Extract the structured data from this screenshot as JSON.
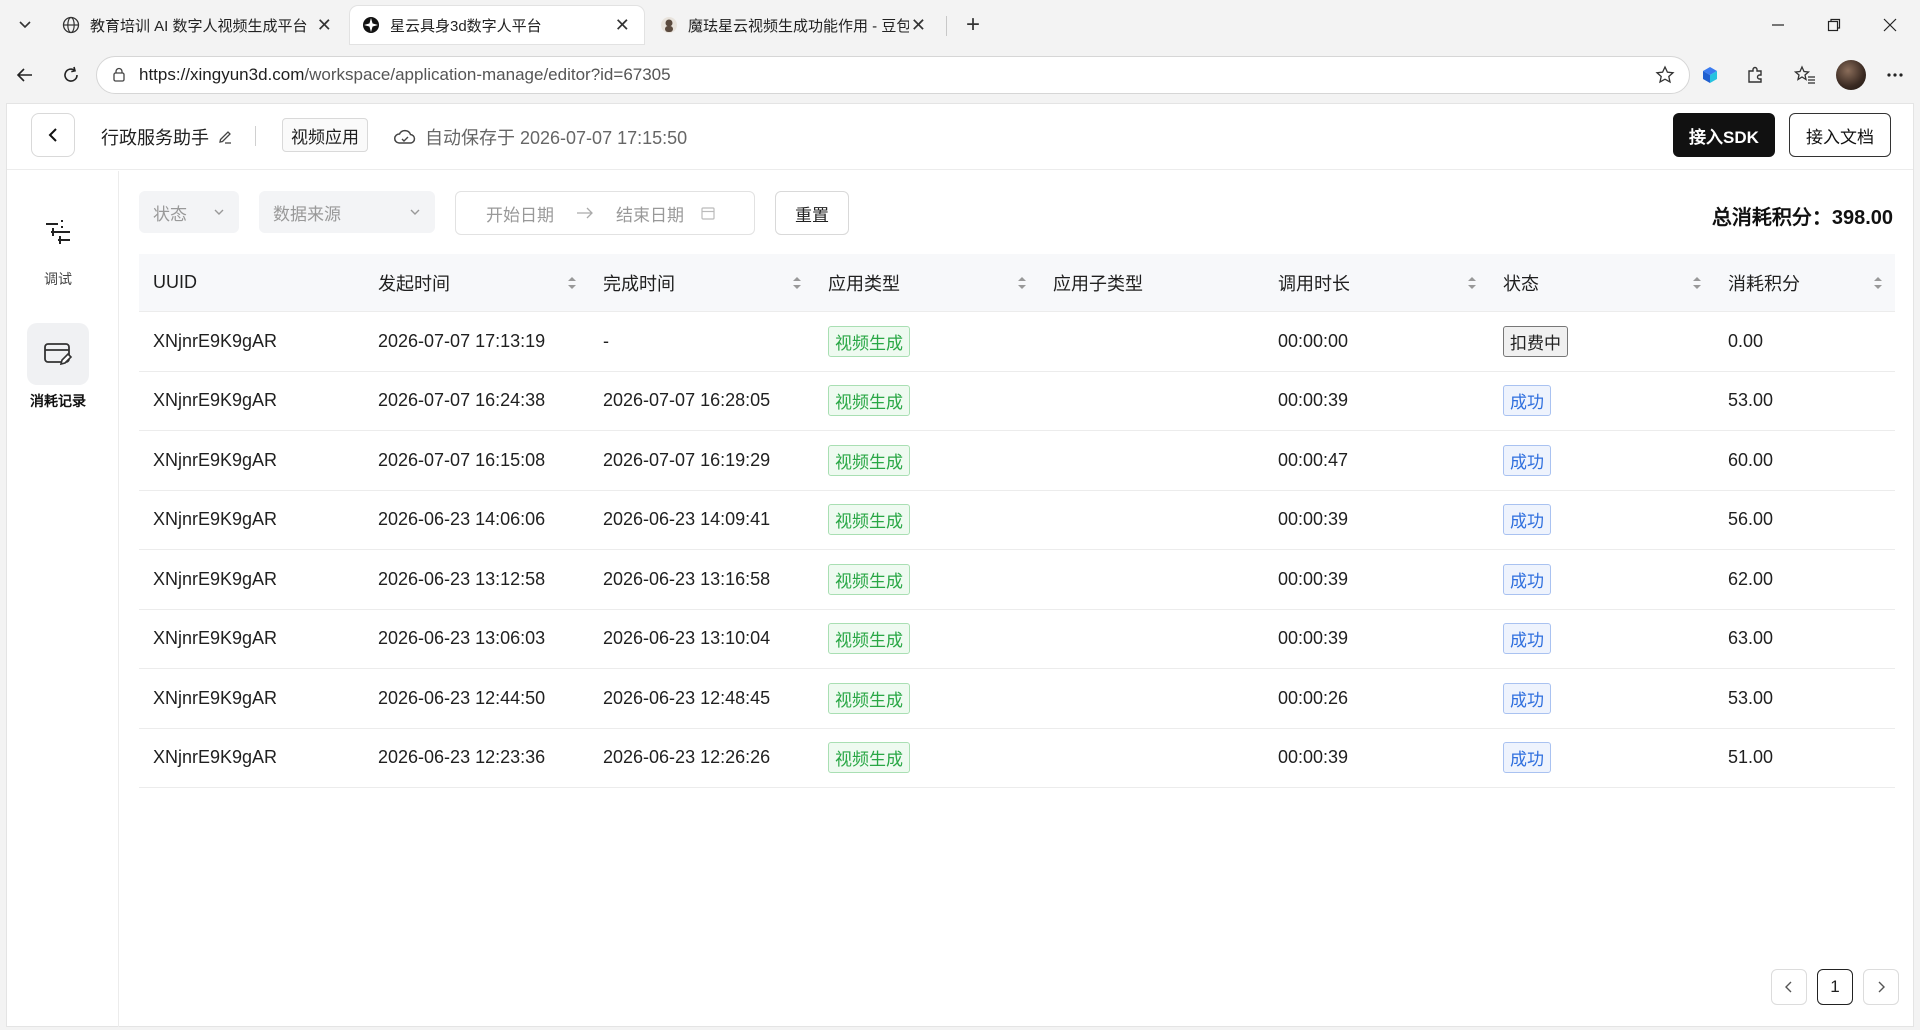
{
  "browser": {
    "tabs": [
      {
        "title": "教育培训 AI 数字人视频生成平台",
        "active": false
      },
      {
        "title": "星云具身3d数字人平台",
        "active": true
      },
      {
        "title": "魔珐星云视频生成功能作用 - 豆包",
        "active": false
      }
    ],
    "url_host": "https://xingyun3d.com",
    "url_path": "/workspace/application-manage/editor?id=67305"
  },
  "header": {
    "app_name": "行政服务助手",
    "app_type": "视频应用",
    "autosave": "自动保存于 2026-07-07 17:15:50",
    "sdk_button": "接入SDK",
    "doc_button": "接入文档"
  },
  "sidenav": {
    "items": [
      {
        "label": "调试",
        "icon": "sliders-icon",
        "active": false
      },
      {
        "label": "消耗记录",
        "icon": "card-edit-icon",
        "active": true
      }
    ]
  },
  "filters": {
    "status_placeholder": "状态",
    "source_placeholder": "数据来源",
    "start_date": "开始日期",
    "end_date": "结束日期",
    "reset": "重置",
    "total_label": "总消耗积分：398.00"
  },
  "table": {
    "columns": [
      "UUID",
      "发起时间",
      "完成时间",
      "应用类型",
      "应用子类型",
      "调用时长",
      "状态",
      "消耗积分"
    ],
    "rows": [
      {
        "uuid": "XNjnrE9K9gAR",
        "start": "2026-07-07 17:13:19",
        "end": "-",
        "type": "视频生成",
        "subtype": "",
        "duration": "00:00:00",
        "status": "扣费中",
        "status_kind": "gray",
        "points": "0.00"
      },
      {
        "uuid": "XNjnrE9K9gAR",
        "start": "2026-07-07 16:24:38",
        "end": "2026-07-07 16:28:05",
        "type": "视频生成",
        "subtype": "",
        "duration": "00:00:39",
        "status": "成功",
        "status_kind": "blue",
        "points": "53.00"
      },
      {
        "uuid": "XNjnrE9K9gAR",
        "start": "2026-07-07 16:15:08",
        "end": "2026-07-07 16:19:29",
        "type": "视频生成",
        "subtype": "",
        "duration": "00:00:47",
        "status": "成功",
        "status_kind": "blue",
        "points": "60.00"
      },
      {
        "uuid": "XNjnrE9K9gAR",
        "start": "2026-06-23 14:06:06",
        "end": "2026-06-23 14:09:41",
        "type": "视频生成",
        "subtype": "",
        "duration": "00:00:39",
        "status": "成功",
        "status_kind": "blue",
        "points": "56.00"
      },
      {
        "uuid": "XNjnrE9K9gAR",
        "start": "2026-06-23 13:12:58",
        "end": "2026-06-23 13:16:58",
        "type": "视频生成",
        "subtype": "",
        "duration": "00:00:39",
        "status": "成功",
        "status_kind": "blue",
        "points": "62.00"
      },
      {
        "uuid": "XNjnrE9K9gAR",
        "start": "2026-06-23 13:06:03",
        "end": "2026-06-23 13:10:04",
        "type": "视频生成",
        "subtype": "",
        "duration": "00:00:39",
        "status": "成功",
        "status_kind": "blue",
        "points": "63.00"
      },
      {
        "uuid": "XNjnrE9K9gAR",
        "start": "2026-06-23 12:44:50",
        "end": "2026-06-23 12:48:45",
        "type": "视频生成",
        "subtype": "",
        "duration": "00:00:26",
        "status": "成功",
        "status_kind": "blue",
        "points": "53.00"
      },
      {
        "uuid": "XNjnrE9K9gAR",
        "start": "2026-06-23 12:23:36",
        "end": "2026-06-23 12:26:26",
        "type": "视频生成",
        "subtype": "",
        "duration": "00:00:39",
        "status": "成功",
        "status_kind": "blue",
        "points": "51.00"
      }
    ]
  },
  "pagination": {
    "current": "1"
  }
}
